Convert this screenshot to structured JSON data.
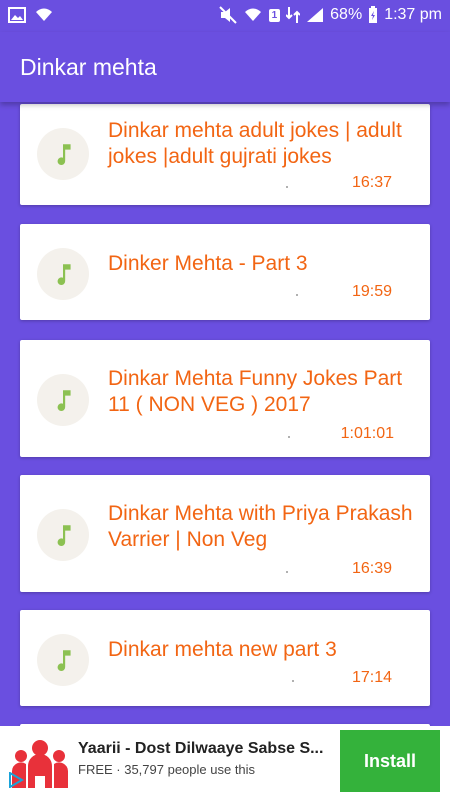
{
  "status_bar": {
    "battery": "68%",
    "time": "1:37 pm",
    "sim": "1"
  },
  "app_bar": {
    "title": "Dinkar mehta"
  },
  "items": [
    {
      "title": "Dinkar mehta adult jokes | adult jokes |adult gujrati jokes",
      "duration": "16:37"
    },
    {
      "title": "Dinker Mehta - Part 3",
      "duration": "19:59"
    },
    {
      "title": "Dinkar Mehta Funny Jokes Part 11 ( NON VEG ) 2017",
      "duration": "1:01:01"
    },
    {
      "title": "Dinkar Mehta with Priya Prakash Varrier | Non Veg",
      "duration": "16:39"
    },
    {
      "title": "Dinkar mehta new part 3",
      "duration": "17:14"
    }
  ],
  "ad": {
    "title": "Yaarii - Dost Dilwaaye Sabse S...",
    "subtitle": "FREE · 35,797 people use this",
    "install_label": "Install"
  },
  "colors": {
    "primary": "#6a4fe0",
    "accent": "#f26513",
    "note_icon": "#8cc152",
    "install": "#34b23b"
  }
}
